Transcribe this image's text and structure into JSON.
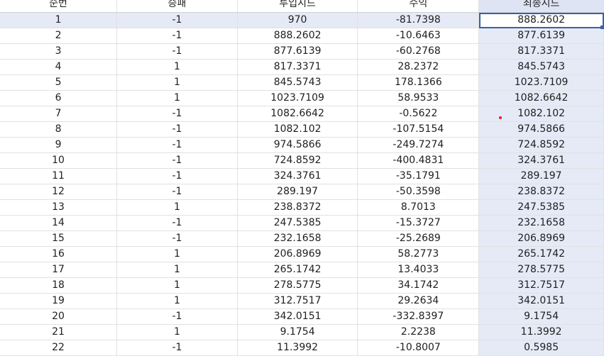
{
  "spreadsheet": {
    "columns": [
      "순번",
      "승패",
      "투입시드",
      "수익",
      "최종시드"
    ],
    "rows": [
      [
        "1",
        "-1",
        "970",
        "-81.7398",
        "888.2602"
      ],
      [
        "2",
        "-1",
        "888.2602",
        "-10.6463",
        "877.6139"
      ],
      [
        "3",
        "-1",
        "877.6139",
        "-60.2768",
        "817.3371"
      ],
      [
        "4",
        "1",
        "817.3371",
        "28.2372",
        "845.5743"
      ],
      [
        "5",
        "1",
        "845.5743",
        "178.1366",
        "1023.7109"
      ],
      [
        "6",
        "1",
        "1023.7109",
        "58.9533",
        "1082.6642"
      ],
      [
        "7",
        "-1",
        "1082.6642",
        "-0.5622",
        "1082.102"
      ],
      [
        "8",
        "-1",
        "1082.102",
        "-107.5154",
        "974.5866"
      ],
      [
        "9",
        "-1",
        "974.5866",
        "-249.7274",
        "724.8592"
      ],
      [
        "10",
        "-1",
        "724.8592",
        "-400.4831",
        "324.3761"
      ],
      [
        "11",
        "-1",
        "324.3761",
        "-35.1791",
        "289.197"
      ],
      [
        "12",
        "-1",
        "289.197",
        "-50.3598",
        "238.8372"
      ],
      [
        "13",
        "1",
        "238.8372",
        "8.7013",
        "247.5385"
      ],
      [
        "14",
        "-1",
        "247.5385",
        "-15.3727",
        "232.1658"
      ],
      [
        "15",
        "-1",
        "232.1658",
        "-25.2689",
        "206.8969"
      ],
      [
        "16",
        "1",
        "206.8969",
        "58.2773",
        "265.1742"
      ],
      [
        "17",
        "1",
        "265.1742",
        "13.4033",
        "278.5775"
      ],
      [
        "18",
        "1",
        "278.5775",
        "34.1742",
        "312.7517"
      ],
      [
        "19",
        "1",
        "312.7517",
        "29.2634",
        "342.0151"
      ],
      [
        "20",
        "-1",
        "342.0151",
        "-332.8397",
        "9.1754"
      ],
      [
        "21",
        "1",
        "9.1754",
        "2.2238",
        "11.3992"
      ],
      [
        "22",
        "-1",
        "11.3992",
        "-10.8007",
        "0.5985"
      ]
    ],
    "selected_row_index": 0,
    "selected_column_index": 4,
    "colors": {
      "selection_highlight": "#e6eaf7",
      "active_cell_border": "#3a5fa8",
      "marker_dot": "#e0212a"
    }
  }
}
